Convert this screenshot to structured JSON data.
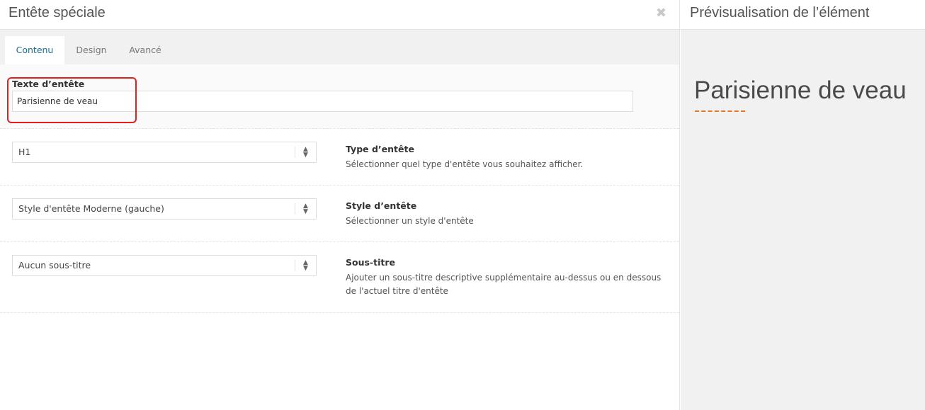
{
  "modal": {
    "title": "Entête spéciale",
    "close_icon": "close-icon",
    "tabs": [
      {
        "label": "Contenu",
        "active": true
      },
      {
        "label": "Design",
        "active": false
      },
      {
        "label": "Avancé",
        "active": false
      }
    ]
  },
  "fields": {
    "header_text": {
      "label": "Texte d’entête",
      "value": "Parisienne de veau"
    },
    "header_type": {
      "selected": "H1",
      "title": "Type d’entête",
      "description": "Sélectionner quel type d'entête vous souhaitez afficher."
    },
    "header_style": {
      "selected": "Style d'entête Moderne (gauche)",
      "title": "Style d’entête",
      "description": "Sélectionner un style d'entête"
    },
    "subtitle": {
      "selected": "Aucun sous-titre",
      "title": "Sous-titre",
      "description": "Ajouter un sous-titre descriptive supplémentaire au-dessus ou en dessous de l'actuel titre d'entête"
    }
  },
  "preview": {
    "title": "Prévisualisation de l’élément",
    "heading": "Parisienne de veau",
    "accent_color": "#e8782a"
  },
  "colors": {
    "highlight": "#e02020",
    "active_tab_text": "#1a6e8e"
  }
}
